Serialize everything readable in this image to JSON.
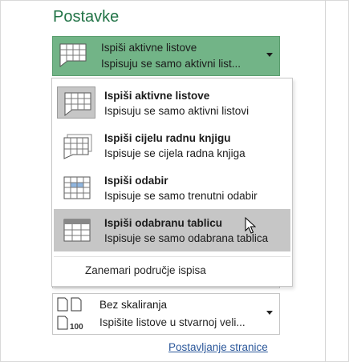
{
  "section_title": "Postavke",
  "print_what": {
    "selected_title": "Ispiši aktivne listove",
    "selected_subtitle": "Ispisuju se samo aktivni list..."
  },
  "menu": {
    "items": [
      {
        "title": "Ispiši aktivne listove",
        "subtitle": "Ispisuju se samo aktivni listovi",
        "icon": "active-sheets-icon"
      },
      {
        "title": "Ispiši cijelu radnu knjigu",
        "subtitle": "Ispisuje se cijela radna knjiga",
        "icon": "workbook-icon"
      },
      {
        "title": "Ispiši odabir",
        "subtitle": "Ispisuje se samo trenutni odabir",
        "icon": "selection-icon"
      },
      {
        "title": "Ispiši odabranu tablicu",
        "subtitle": "Ispisuje se samo odabrana tablica",
        "icon": "table-icon"
      }
    ],
    "ignore_print_area": "Zanemari područje ispisa"
  },
  "scaling": {
    "title": "Bez skaliranja",
    "subtitle": "Ispišite listove u stvarnoj veli...",
    "icon_text": "100"
  },
  "page_setup_link": "Postavljanje stranice",
  "colors": {
    "accent": "#217346",
    "selected_button": "#72b487",
    "hover": "#c6c6c6",
    "link": "#2b579a"
  }
}
